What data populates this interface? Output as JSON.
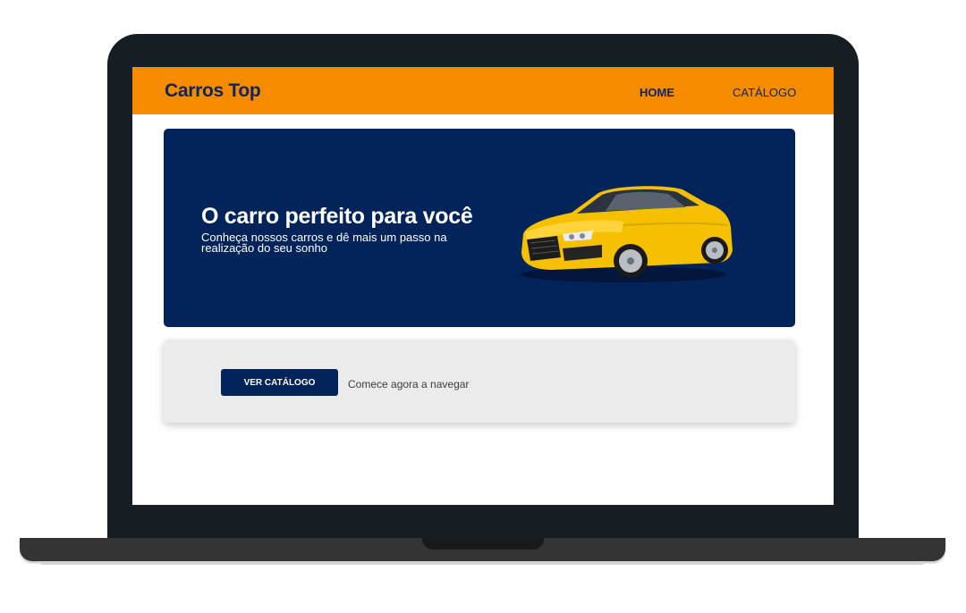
{
  "brand": "Carros Top",
  "nav": {
    "home_label": "HOME",
    "catalog_label": "CATÁLOGO"
  },
  "hero": {
    "title": "O carro perfeito para você",
    "subtitle": "Conheça nossos carros e dê mais um passo na realização do seu sonho",
    "image": "yellow-sports-car"
  },
  "cta": {
    "button_label": "VER CATÁLOGO",
    "text": "Comece agora a navegar"
  },
  "colors": {
    "navbar": "#f68b00",
    "primary": "#03245a",
    "cta_background": "#ebebeb"
  }
}
